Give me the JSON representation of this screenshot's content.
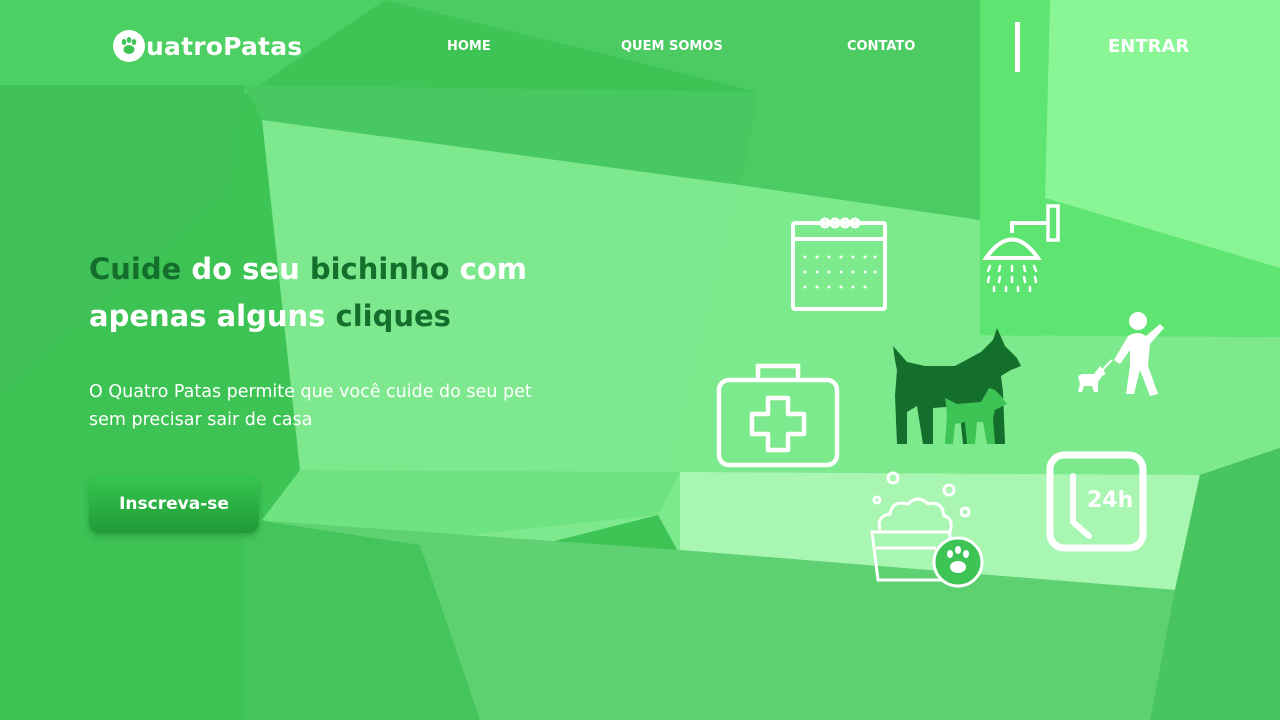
{
  "brand": {
    "letter": "Q",
    "rest": "uatroPatas",
    "icon": "paw-icon"
  },
  "nav": {
    "home": "HOME",
    "about": "QUEM SOMOS",
    "contact": "CONTATO",
    "login": "ENTRAR"
  },
  "hero": {
    "title_part1": "Cuide",
    "title_part2": " do seu ",
    "title_part3": "bichinho",
    "title_part4": " com apenas alguns ",
    "title_part5": "cliques",
    "subtitle": "O Quatro Patas permite que você cuide do seu pet sem precisar sair de casa",
    "cta": "Inscreva-se"
  },
  "illustrations": {
    "icons": [
      "calendar-icon",
      "shower-icon",
      "first-aid-kit-icon",
      "dogs-icon",
      "dog-walker-icon",
      "pet-bath-icon",
      "clock-24h-icon"
    ],
    "clock_label": "24h"
  },
  "colors": {
    "base_green": "#3ec455",
    "dark_green": "#146e2c",
    "light_green": "#7fe88e",
    "button_top": "#36c74f",
    "button_bottom": "#1f9b37"
  }
}
